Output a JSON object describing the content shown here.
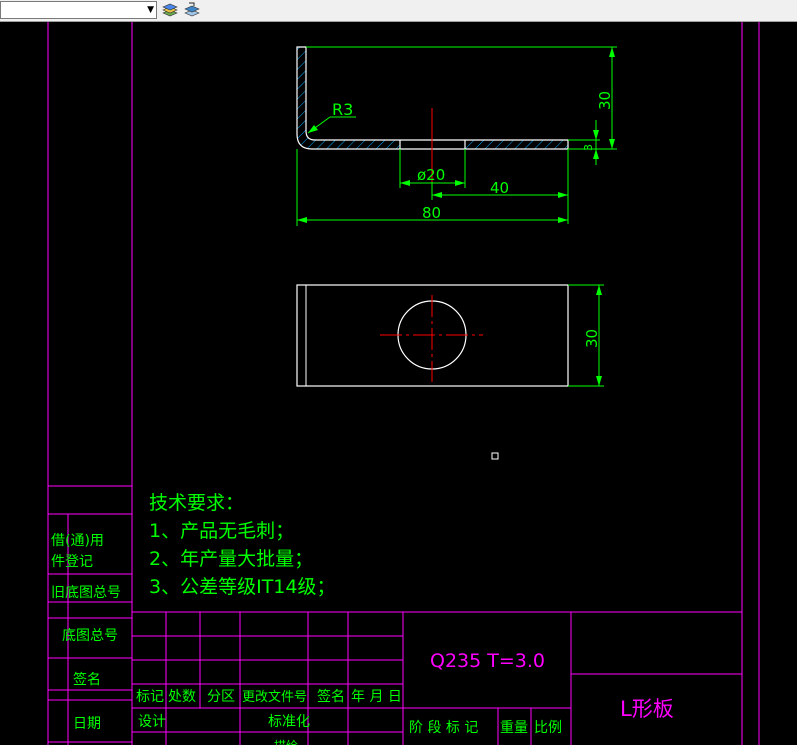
{
  "toolbar": {
    "layer_combo_value": "",
    "icons": [
      "layer-manager-icon",
      "layer-previous-icon"
    ]
  },
  "colors": {
    "background": "#000000",
    "frame": "#ff00ff",
    "geometry": "#ffffff",
    "dimension": "#00ff00",
    "centerline": "#ff0000",
    "hatch": "#00aaff"
  },
  "drawing": {
    "front_view_dims": {
      "radius": "R3",
      "hole_diameter": "ø20",
      "hole_offset": "40",
      "overall_length": "80",
      "height": "30",
      "thickness": "3"
    },
    "top_view_dims": {
      "width": "30"
    }
  },
  "notes": {
    "title": "技术要求：",
    "items": [
      "1、产品无毛刺；",
      "2、年产量大批量；",
      "3、公差等级IT14级；"
    ]
  },
  "left_strip": {
    "borrow_register": [
      "借(通)用",
      "件登记"
    ],
    "old_base_no": "旧底图总号",
    "base_no": "底图总号",
    "signature": "签名",
    "date": "日期"
  },
  "title_block": {
    "material": "Q235  T=3.0",
    "part_name": "L形板",
    "revision_headers": [
      "标记",
      "处数",
      "分区",
      "更改文件号",
      "签名",
      "年 月 日"
    ],
    "design": "设计",
    "standardize": "标准化",
    "partial_text": "描绘",
    "stage_headers": [
      "阶 段 标 记",
      "重量",
      "比例"
    ]
  }
}
